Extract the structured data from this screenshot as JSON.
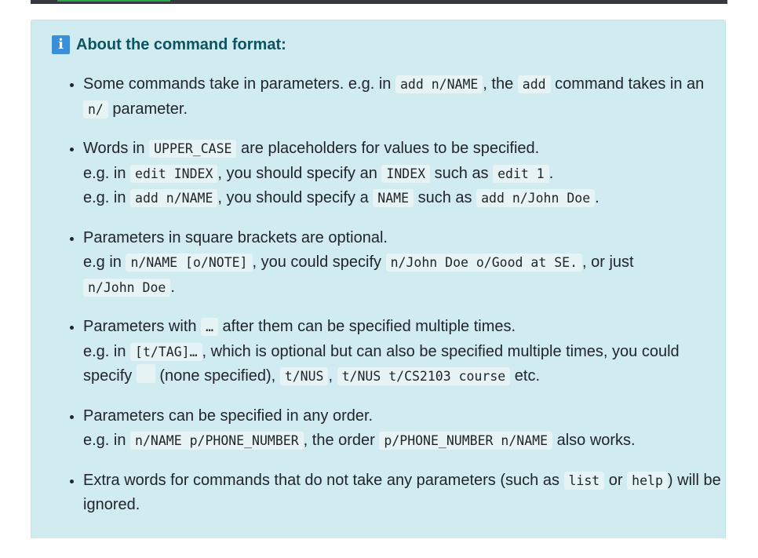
{
  "box": {
    "icon": "i",
    "title": "About the command format:"
  },
  "items": [
    {
      "l1": {
        "t1": "Some commands take in parameters. e.g. in ",
        "c1": "add n/NAME",
        "t2": ", the ",
        "c2": "add",
        "t3": " command takes in an ",
        "c3": "n/",
        "t4": " parameter."
      }
    },
    {
      "l1": {
        "t1": "Words in ",
        "c1": "UPPER_CASE",
        "t2": " are placeholders for values to be specified."
      },
      "l2": {
        "t1": "e.g. in ",
        "c1": "edit INDEX",
        "t2": ", you should specify an ",
        "c2": "INDEX",
        "t3": " such as ",
        "c3": "edit 1",
        "t4": "."
      },
      "l3": {
        "t1": "e.g. in ",
        "c1": "add n/NAME",
        "t2": ", you should specify a ",
        "c2": "NAME",
        "t3": " such as ",
        "c3": "add n/John Doe",
        "t4": "."
      }
    },
    {
      "l1": {
        "t1": "Parameters in square brackets are optional."
      },
      "l2": {
        "t1": "e.g in ",
        "c1": "n/NAME [o/NOTE]",
        "t2": ", you could specify ",
        "c2": "n/John Doe o/Good at SE.",
        "t3": ", or just ",
        "c3": "n/John Doe",
        "t4": "."
      }
    },
    {
      "l1": {
        "t1": "Parameters with ",
        "c1": "…",
        "t2": " after them can be specified multiple times."
      },
      "l2": {
        "t1": "e.g. in ",
        "c1": "[t/TAG]…",
        "t2": ", which is optional but can also be specified multiple times, you could specify ",
        "t3": " (none specified), ",
        "c2": "t/NUS",
        "t4": ", ",
        "c3": "t/NUS t/CS2103 course",
        "t5": " etc."
      }
    },
    {
      "l1": {
        "t1": "Parameters can be specified in any order."
      },
      "l2": {
        "t1": "e.g. in ",
        "c1": "n/NAME p/PHONE_NUMBER",
        "t2": ", the order ",
        "c2": "p/PHONE_NUMBER n/NAME",
        "t3": " also works."
      }
    },
    {
      "l1": {
        "t1": "Extra words for commands that do not take any parameters (such as ",
        "c1": "list",
        "t2": " or ",
        "c2": "help",
        "t3": ") will be ignored."
      }
    }
  ]
}
